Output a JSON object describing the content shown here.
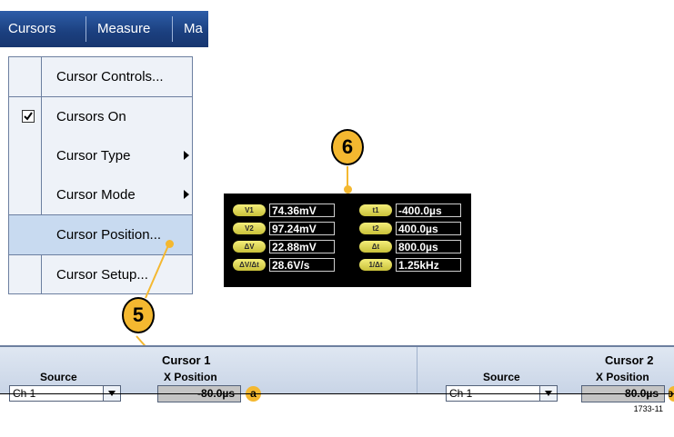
{
  "menubar": {
    "items": [
      "Cursors",
      "Measure",
      "Ma"
    ]
  },
  "menu": {
    "items": [
      {
        "label": "Cursor Controls...",
        "checked": false,
        "submenu": false
      },
      {
        "label": "Cursors On",
        "checked": true,
        "submenu": false
      },
      {
        "label": "Cursor Type",
        "checked": false,
        "submenu": true
      },
      {
        "label": "Cursor Mode",
        "checked": false,
        "submenu": true
      },
      {
        "label": "Cursor Position...",
        "checked": false,
        "submenu": false,
        "highlighted": true
      },
      {
        "label": "Cursor Setup...",
        "checked": false,
        "submenu": false
      }
    ]
  },
  "callouts": {
    "five": "5",
    "six": "6"
  },
  "readout": {
    "left": [
      {
        "tag": "V1",
        "value": "74.36mV"
      },
      {
        "tag": "V2",
        "value": "97.24mV"
      },
      {
        "tag": "ΔV",
        "value": "22.88mV"
      },
      {
        "tag": "ΔV/Δt",
        "value": "28.6V/s"
      }
    ],
    "right": [
      {
        "tag": "t1",
        "value": "-400.0µs"
      },
      {
        "tag": "t2",
        "value": "400.0µs"
      },
      {
        "tag": "Δt",
        "value": "800.0µs"
      },
      {
        "tag": "1/Δt",
        "value": "1.25kHz"
      }
    ]
  },
  "panel": {
    "cursor1": {
      "title": "Cursor 1",
      "source_label": "Source",
      "source_value": "Ch 1",
      "xpos_label": "X Position",
      "xpos_value": "-80.0µs",
      "marker": "a"
    },
    "cursor2": {
      "title": "Cursor 2",
      "source_label": "Source",
      "source_value": "Ch 1",
      "xpos_label": "X Position",
      "xpos_value": "80.0µs",
      "marker": "b"
    }
  },
  "figure_number": "1733-11"
}
